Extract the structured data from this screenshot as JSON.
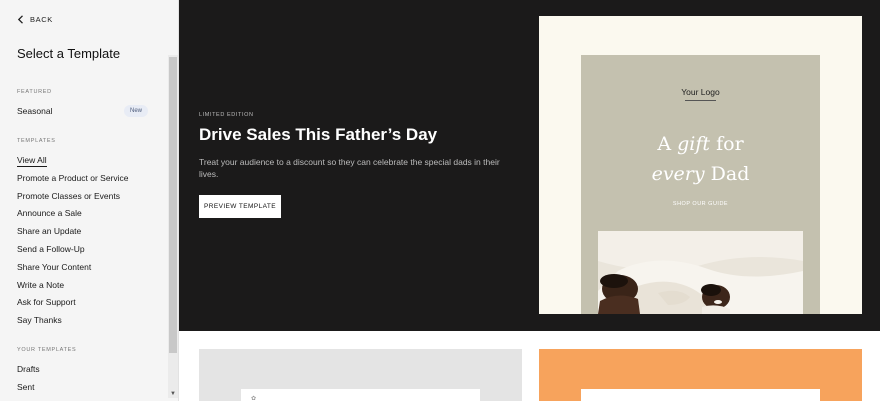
{
  "sidebar": {
    "back_label": "BACK",
    "title": "Select a Template",
    "featured_label": "FEATURED",
    "seasonal_label": "Seasonal",
    "seasonal_badge": "New",
    "templates_label": "TEMPLATES",
    "templates": [
      {
        "label": "View All",
        "active": true
      },
      {
        "label": "Promote a Product or Service"
      },
      {
        "label": "Promote Classes or Events"
      },
      {
        "label": "Announce a Sale"
      },
      {
        "label": "Share an Update"
      },
      {
        "label": "Send a Follow-Up"
      },
      {
        "label": "Share Your Content"
      },
      {
        "label": "Write a Note"
      },
      {
        "label": "Ask for Support"
      },
      {
        "label": "Say Thanks"
      }
    ],
    "your_templates_label": "YOUR TEMPLATES",
    "your_templates": [
      {
        "label": "Drafts"
      },
      {
        "label": "Sent"
      }
    ]
  },
  "hero": {
    "eyebrow": "LIMITED EDITION",
    "title": "Drive Sales This Father’s Day",
    "description": "Treat your audience to a discount so they can celebrate the special dads in their lives.",
    "preview_button": "PREVIEW TEMPLATE"
  },
  "email_preview": {
    "logo": "Your Logo",
    "headline_a": "A",
    "headline_gift": "gift",
    "headline_for": "for",
    "headline_every": "every",
    "headline_dad": "Dad",
    "cta": "SHOP OUR GUIDE"
  },
  "colors": {
    "hero_bg": "#1b1a1a",
    "email_bg": "#c4c1af",
    "card_cream": "#fbf9ef",
    "card_orange": "#f7a35c",
    "card_grey": "#e4e4e4"
  }
}
